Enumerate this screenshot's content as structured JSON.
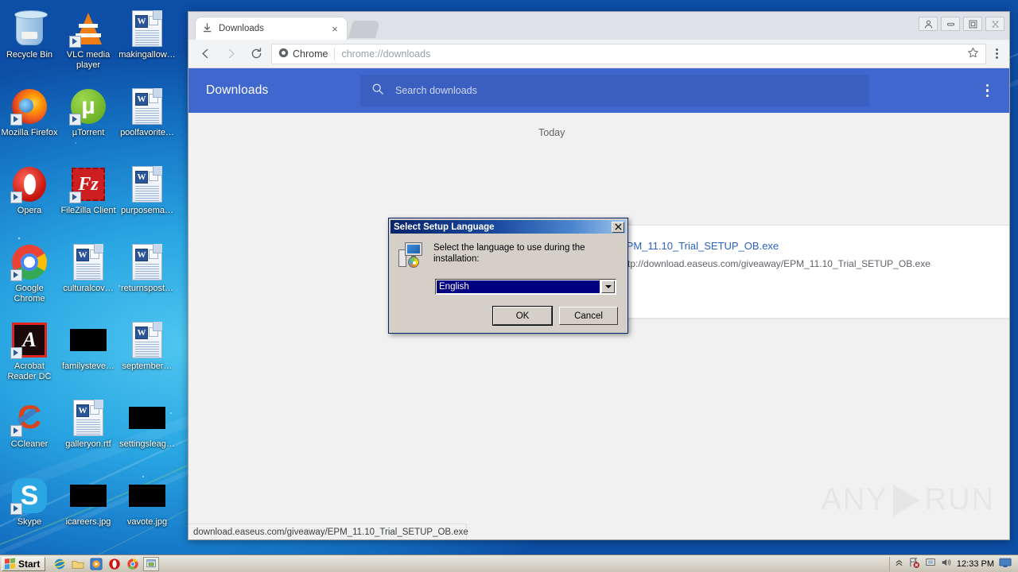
{
  "desktop": {
    "icons": [
      {
        "label": "Recycle Bin",
        "icon": "recycle-bin-icon",
        "shortcut": false
      },
      {
        "label": "VLC media player",
        "icon": "vlc-media-player-icon",
        "shortcut": true
      },
      {
        "label": "makingallow…",
        "icon": "word-document-icon",
        "shortcut": false
      },
      {
        "label": "Mozilla Firefox",
        "icon": "firefox-icon",
        "shortcut": true
      },
      {
        "label": "µTorrent",
        "icon": "utorrent-icon",
        "shortcut": true
      },
      {
        "label": "poolfavorite…",
        "icon": "word-document-icon",
        "shortcut": false
      },
      {
        "label": "Opera",
        "icon": "opera-icon",
        "shortcut": true
      },
      {
        "label": "FileZilla Client",
        "icon": "filezilla-icon",
        "shortcut": true
      },
      {
        "label": "purposema…",
        "icon": "word-document-icon",
        "shortcut": false
      },
      {
        "label": "Google Chrome",
        "icon": "chrome-icon",
        "shortcut": true
      },
      {
        "label": "culturalcov…",
        "icon": "word-document-icon",
        "shortcut": false
      },
      {
        "label": "returnspost…",
        "icon": "word-document-icon",
        "shortcut": false
      },
      {
        "label": "Acrobat Reader DC",
        "icon": "acrobat-reader-icon",
        "shortcut": true
      },
      {
        "label": "familysteve…",
        "icon": "image-thumbnail-black",
        "shortcut": false
      },
      {
        "label": "september…",
        "icon": "word-document-icon",
        "shortcut": false
      },
      {
        "label": "CCleaner",
        "icon": "ccleaner-icon",
        "shortcut": true
      },
      {
        "label": "galleryon.rtf",
        "icon": "word-document-icon",
        "shortcut": false
      },
      {
        "label": "settingsleag…",
        "icon": "image-thumbnail-black",
        "shortcut": false
      },
      {
        "label": "Skype",
        "icon": "skype-icon",
        "shortcut": true
      },
      {
        "label": "icareers.jpg",
        "icon": "image-thumbnail-black",
        "shortcut": false
      },
      {
        "label": "vavote.jpg",
        "icon": "image-thumbnail-black",
        "shortcut": false
      }
    ]
  },
  "browser": {
    "tab": {
      "title": "Downloads",
      "favicon": "download-icon",
      "close_label": "×"
    },
    "new_tab_label": "",
    "window_controls": [
      {
        "name": "profile-button",
        "glyph": "☺"
      },
      {
        "name": "minimize-button",
        "glyph": "–"
      },
      {
        "name": "maximize-button",
        "glyph": "□"
      },
      {
        "name": "close-button",
        "glyph": "✕"
      }
    ],
    "toolbar": {
      "back_glyph": "←",
      "forward_glyph": "→",
      "reload_glyph": "↻",
      "secure_label": "Chrome",
      "url": "chrome://downloads",
      "star_glyph": "☆"
    },
    "status_bar": "download.easeus.com/giveaway/EPM_11.10_Trial_SETUP_OB.exe",
    "watermark": {
      "left": "ANY",
      "right": "RUN"
    }
  },
  "downloads_page": {
    "header_title": "Downloads",
    "search_placeholder": "Search downloads",
    "accent_color": "#3f67ce",
    "day_label": "Today",
    "items": [
      {
        "filename": "EPM_11.10_Trial_SETUP_OB.exe",
        "url": "http://download.easeus.com/giveaway/EPM_11.10_Trial_SETUP_OB.exe",
        "remove_glyph": "✕",
        "file_icon": "generic-executable-icon"
      }
    ]
  },
  "dialog": {
    "title": "Select Setup Language",
    "close_glyph": "✕",
    "icon": "setup-computer-cd-icon",
    "message_line1": "Select the language to use during the",
    "message_line2": "installation:",
    "combo_value": "English",
    "combo_arrow": "▼",
    "buttons": [
      {
        "label": "OK",
        "default": true
      },
      {
        "label": "Cancel",
        "default": false
      }
    ]
  },
  "taskbar": {
    "start_label": "Start",
    "quick_launch": [
      {
        "name": "internet-explorer-icon"
      },
      {
        "name": "windows-explorer-icon"
      },
      {
        "name": "media-player-icon"
      },
      {
        "name": "opera-icon"
      },
      {
        "name": "chrome-icon"
      },
      {
        "name": "setup-installer-window",
        "active": true
      }
    ],
    "tray": {
      "show_hidden_glyph": "«",
      "network_glyph": "net",
      "volume_glyph": "vol",
      "time": "12:33 PM",
      "show_desktop_glyph": "desk"
    }
  }
}
